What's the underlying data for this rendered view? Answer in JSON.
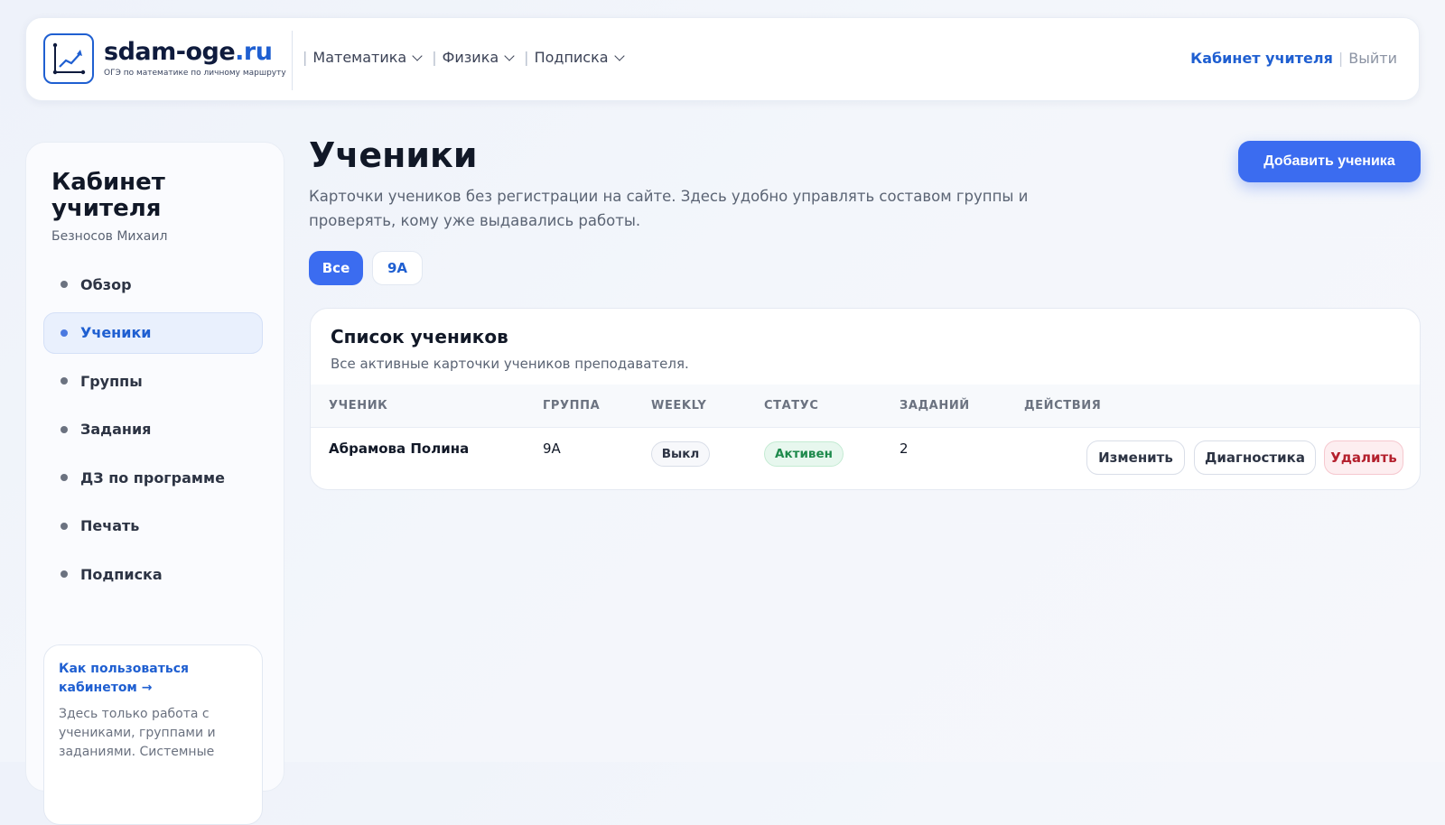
{
  "header": {
    "brand_main": "sdam-oge",
    "brand_tld": ".ru",
    "brand_tagline": "ОГЭ по математике по личному маршруту",
    "nav": [
      {
        "label": "Математика"
      },
      {
        "label": "Физика"
      },
      {
        "label": "Подписка"
      }
    ],
    "cabinet_link": "Кабинет учителя",
    "logout_link": "Выйти"
  },
  "sidebar": {
    "title": "Кабинет учителя",
    "user_name": "Безносов Михаил",
    "items": [
      {
        "label": "Обзор",
        "active": false
      },
      {
        "label": "Ученики",
        "active": true
      },
      {
        "label": "Группы",
        "active": false
      },
      {
        "label": "Задания",
        "active": false
      },
      {
        "label": "ДЗ по программе",
        "active": false
      },
      {
        "label": "Печать",
        "active": false
      },
      {
        "label": "Подписка",
        "active": false
      }
    ],
    "help": {
      "link": "Как пользоваться кабинетом →",
      "text": "Здесь только работа с учениками, группами и заданиями. Системные"
    }
  },
  "main": {
    "title": "Ученики",
    "description": "Карточки учеников без регистрации на сайте. Здесь удобно управлять составом группы и проверять, кому уже выдавались работы.",
    "add_button": "Добавить ученика",
    "filters": [
      {
        "label": "Все",
        "active": true
      },
      {
        "label": "9А",
        "active": false
      }
    ],
    "list": {
      "title": "Список учеников",
      "subtitle": "Все активные карточки учеников преподавателя.",
      "columns": [
        "УЧЕНИК",
        "ГРУППА",
        "WEEKLY",
        "СТАТУС",
        "ЗАДАНИЙ",
        "ДЕЙСТВИЯ"
      ],
      "rows": [
        {
          "name": "Абрамова Полина",
          "group": "9А",
          "weekly": "Выкл",
          "status": "Активен",
          "tasks": "2",
          "actions": {
            "edit": "Изменить",
            "diagnostics": "Диагностика",
            "delete": "Удалить"
          }
        }
      ]
    }
  },
  "colors": {
    "accent": "#3b6cf0",
    "brand": "#1f5fd1",
    "status_active": "#1e8a4c",
    "danger": "#b4202d"
  }
}
